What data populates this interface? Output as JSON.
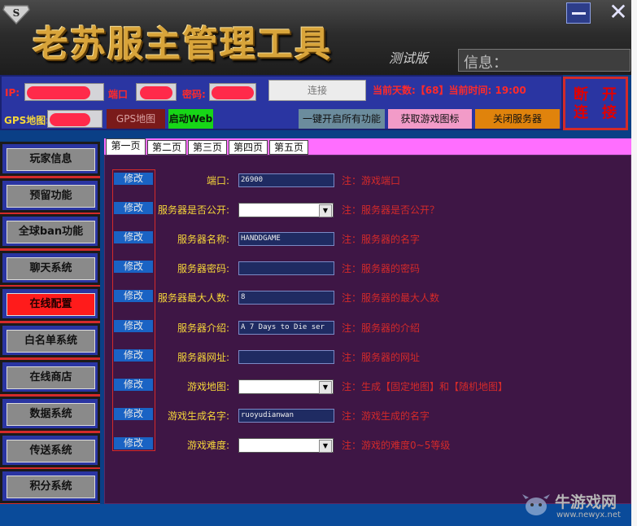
{
  "header": {
    "title": "老苏服主管理工具",
    "test_label": "测试版",
    "info_label": "信息：",
    "close_glyph": "✕"
  },
  "connection": {
    "ip_label": "IP:",
    "port_label": "端口",
    "password_label": "密码:",
    "connect_button": "连接",
    "status_text": "当前天数:【68】当前时间: 19:00",
    "gps_label": "GPS地图:",
    "gps_map_button": "GPS地图",
    "start_web_button": "启动Web",
    "enable_all_button": "一键开启所有功能",
    "get_icon_button": "获取游戏图标",
    "close_server_button": "关闭服务器",
    "disconnect": [
      "断",
      "连",
      "开",
      "接"
    ]
  },
  "sidebar": {
    "items": [
      "玩家信息",
      "预留功能",
      "全球ban功能",
      "聊天系统",
      "在线配置",
      "白名单系统",
      "在线商店",
      "数据系统",
      "传送系统",
      "积分系统"
    ],
    "active_index": 4
  },
  "tabs": [
    "第一页",
    "第二页",
    "第三页",
    "第四页",
    "第五页"
  ],
  "active_tab": 0,
  "edit_label": "修改",
  "settings": [
    {
      "label": "端口:",
      "type": "input",
      "value": "26900",
      "note": "注：游戏端口"
    },
    {
      "label": "服务器是否公开:",
      "type": "select",
      "value": "",
      "note": "注：服务器是否公开？"
    },
    {
      "label": "服务器名称:",
      "type": "input",
      "value": "HANDDGAME",
      "note": "注：服务器的名字"
    },
    {
      "label": "服务器密码:",
      "type": "input",
      "value": "",
      "note": "注：服务器的密码"
    },
    {
      "label": "服务器最大人数:",
      "type": "input",
      "value": "8",
      "note": "注：服务器的最大人数"
    },
    {
      "label": "服务器介绍:",
      "type": "input",
      "value": "A 7 Days to Die ser",
      "note": "注：服务器的介绍"
    },
    {
      "label": "服务器网址:",
      "type": "input",
      "value": "",
      "note": "注：服务器的网址"
    },
    {
      "label": "游戏地图:",
      "type": "select",
      "value": "",
      "note": "注：生成【固定地图】和【随机地图】"
    },
    {
      "label": "游戏生成名字:",
      "type": "input",
      "value": "ruoyudianwan",
      "note": "注：游戏生成的名字"
    },
    {
      "label": "游戏难度:",
      "type": "select",
      "value": "",
      "note": "注：游戏的难度0~5等级"
    }
  ],
  "watermark": {
    "name": "牛游戏网",
    "url": "www.newyx.net"
  },
  "colors": {
    "accent_red": "#d42a2a",
    "panel_blue": "#2a35a2",
    "panel_purple": "#3e1645",
    "label_yellow": "#f5d63a"
  }
}
